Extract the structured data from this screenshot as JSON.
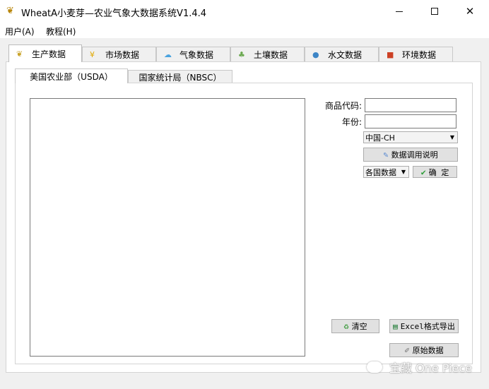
{
  "window": {
    "title": "WheatA小麦芽—农业气象大数据系统V1.4.4"
  },
  "menu": [
    "用户(A)",
    "教程(H)"
  ],
  "tabs": [
    {
      "label": "生产数据",
      "icon": "wheat-icon"
    },
    {
      "label": "市场数据",
      "icon": "yen-icon"
    },
    {
      "label": "气象数据",
      "icon": "cloud-icon"
    },
    {
      "label": "土壤数据",
      "icon": "plant-icon"
    },
    {
      "label": "水文数据",
      "icon": "water-icon"
    },
    {
      "label": "环境数据",
      "icon": "car-icon"
    }
  ],
  "subtabs": [
    "美国农业部（USDA）",
    "国家统计局（NBSC）"
  ],
  "form": {
    "commodity_label": "商品代码:",
    "commodity_value": "",
    "year_label": "年份:",
    "year_value": "",
    "region_selected": "中国-CH",
    "help_button": "数据调用说明",
    "country_select": "各国数据",
    "confirm_button": "确 定"
  },
  "actions": {
    "clear": "清空",
    "export": "Excel格式导出",
    "raw": "原始数据"
  },
  "watermark": "宝藏 One Piece"
}
